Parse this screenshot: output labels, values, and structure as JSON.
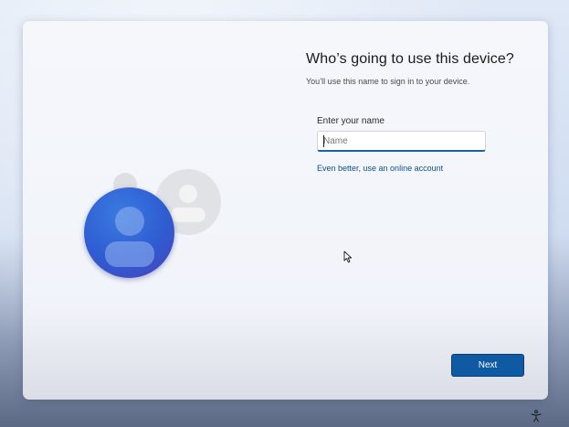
{
  "setup": {
    "title": "Who’s going to use this device?",
    "subtitle": "You’ll use this name to sign in to your device.",
    "name_field": {
      "label": "Enter your name",
      "placeholder": "Name",
      "value": ""
    },
    "online_account_link": "Even better, use an online account",
    "next_button": "Next"
  },
  "icons": {
    "user_avatar": "user-avatar-icon",
    "cursor": "mouse-pointer-icon",
    "accessibility": "accessibility-icon"
  },
  "colors": {
    "accent": "#0f5aa3",
    "link": "#0f4f8c",
    "avatar_blue": "#2f5cd2"
  }
}
